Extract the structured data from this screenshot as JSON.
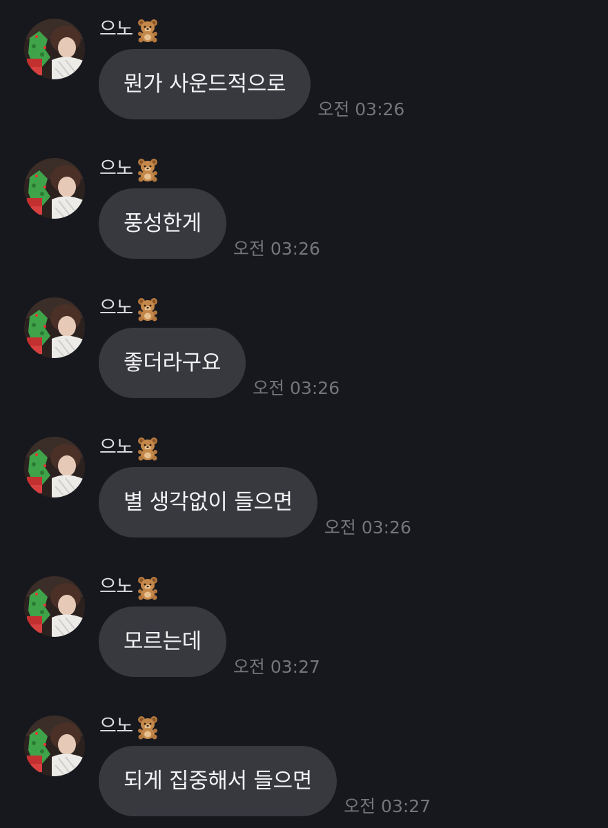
{
  "chat": {
    "messages": [
      {
        "sender": "으노",
        "text": "뭔가 사운드적으로",
        "time": "오전 03:26"
      },
      {
        "sender": "으노",
        "text": "풍성한게",
        "time": "오전 03:26"
      },
      {
        "sender": "으노",
        "text": "좋더라구요",
        "time": "오전 03:26"
      },
      {
        "sender": "으노",
        "text": "별 생각없이 들으면",
        "time": "오전 03:26"
      },
      {
        "sender": "으노",
        "text": "모르는데",
        "time": "오전 03:27"
      },
      {
        "sender": "으노",
        "text": "되게 집중해서 들으면",
        "time": "오전 03:27"
      }
    ]
  },
  "icons": {
    "avatar": "profile-photo-avatar",
    "sender_badge": "teddy-bear-emoji-icon"
  },
  "colors": {
    "background": "#17181d",
    "bubble": "#38393f",
    "message_text": "#f3f3f5",
    "timestamp": "#75767c",
    "sender_name": "#e2e2e6"
  }
}
